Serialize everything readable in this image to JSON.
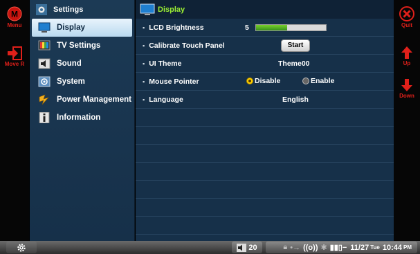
{
  "sidebar_left": {
    "menu_label": "Menu",
    "move_label": "Move R"
  },
  "sidebar_right": {
    "quit_label": "Quit",
    "up_label": "Up",
    "down_label": "Down"
  },
  "settings_panel": {
    "title": "Settings",
    "items": [
      {
        "label": "Display",
        "icon": "monitor-icon",
        "selected": true
      },
      {
        "label": "TV Settings",
        "icon": "tv-icon",
        "selected": false
      },
      {
        "label": "Sound",
        "icon": "speaker-icon",
        "selected": false
      },
      {
        "label": "System",
        "icon": "system-icon",
        "selected": false
      },
      {
        "label": "Power Management",
        "icon": "power-icon",
        "selected": false
      },
      {
        "label": "Information",
        "icon": "info-icon",
        "selected": false
      }
    ]
  },
  "display": {
    "header": "Display",
    "lcd_brightness": {
      "label": "LCD Brightness",
      "value": "5",
      "level": 0.45
    },
    "calibrate": {
      "label": "Calibrate Touch Panel",
      "button": "Start"
    },
    "ui_theme": {
      "label": "UI Theme",
      "value": "Theme00"
    },
    "mouse_pointer": {
      "label": "Mouse Pointer",
      "option_disable": "Disable",
      "option_enable": "Enable",
      "selected": "Disable"
    },
    "language": {
      "label": "Language",
      "value": "English"
    }
  },
  "taskbar": {
    "volume": "20",
    "wifi": "((o))",
    "date": "11/27",
    "weekday": "Tue",
    "time": "10:44",
    "ampm": "PM"
  },
  "colors": {
    "accent_red": "#e0201a",
    "header_green": "#9cef34",
    "panel_blue": "#163049"
  }
}
